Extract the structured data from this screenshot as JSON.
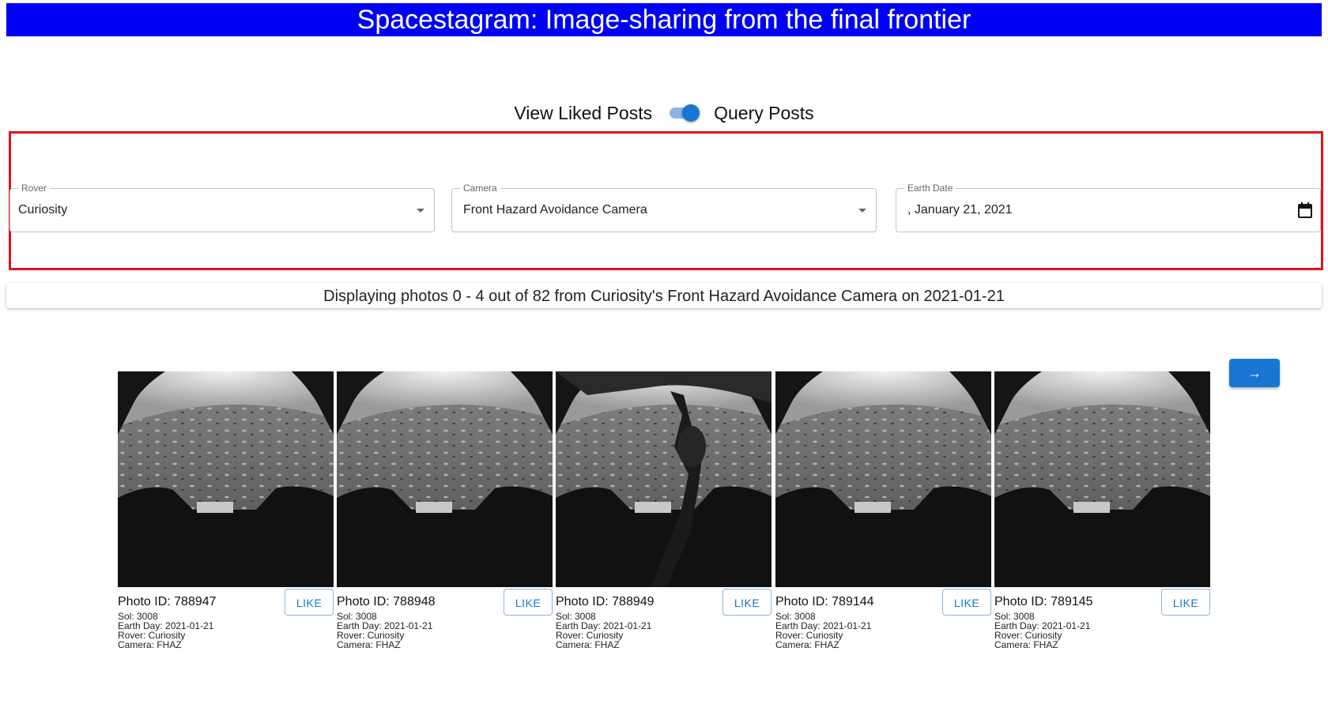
{
  "header": {
    "title": "Spacestagram: Image-sharing from the final frontier"
  },
  "view_toggle": {
    "left_label": "View Liked Posts",
    "right_label": "Query Posts",
    "checked": true
  },
  "filters": {
    "rover": {
      "label": "Rover",
      "value": "Curiosity"
    },
    "camera": {
      "label": "Camera",
      "value": "Front Hazard Avoidance Camera"
    },
    "earth_date": {
      "label": "Earth Date",
      "value": ", January 21, 2021"
    }
  },
  "status": {
    "text": "Displaying photos 0 - 4 out of 82 from Curiosity's Front Hazard Avoidance Camera on 2021-01-21"
  },
  "pagination": {
    "next_label": "→"
  },
  "colors": {
    "banner": "#0000f5",
    "primary": "#1976d2",
    "highlight_border": "#e0141e"
  },
  "photos": [
    {
      "id_label": "Photo ID: 788947",
      "like_label": "LIKE",
      "sol": "Sol: 3008",
      "earth_day": "Earth Day: 2021-01-21",
      "rover": "Rover: Curiosity",
      "camera": "Camera: FHAZ"
    },
    {
      "id_label": "Photo ID: 788948",
      "like_label": "LIKE",
      "sol": "Sol: 3008",
      "earth_day": "Earth Day: 2021-01-21",
      "rover": "Rover: Curiosity",
      "camera": "Camera: FHAZ"
    },
    {
      "id_label": "Photo ID: 788949",
      "like_label": "LIKE",
      "sol": "Sol: 3008",
      "earth_day": "Earth Day: 2021-01-21",
      "rover": "Rover: Curiosity",
      "camera": "Camera: FHAZ"
    },
    {
      "id_label": "Photo ID: 789144",
      "like_label": "LIKE",
      "sol": "Sol: 3008",
      "earth_day": "Earth Day: 2021-01-21",
      "rover": "Rover: Curiosity",
      "camera": "Camera: FHAZ"
    },
    {
      "id_label": "Photo ID: 789145",
      "like_label": "LIKE",
      "sol": "Sol: 3008",
      "earth_day": "Earth Day: 2021-01-21",
      "rover": "Rover: Curiosity",
      "camera": "Camera: FHAZ"
    }
  ]
}
